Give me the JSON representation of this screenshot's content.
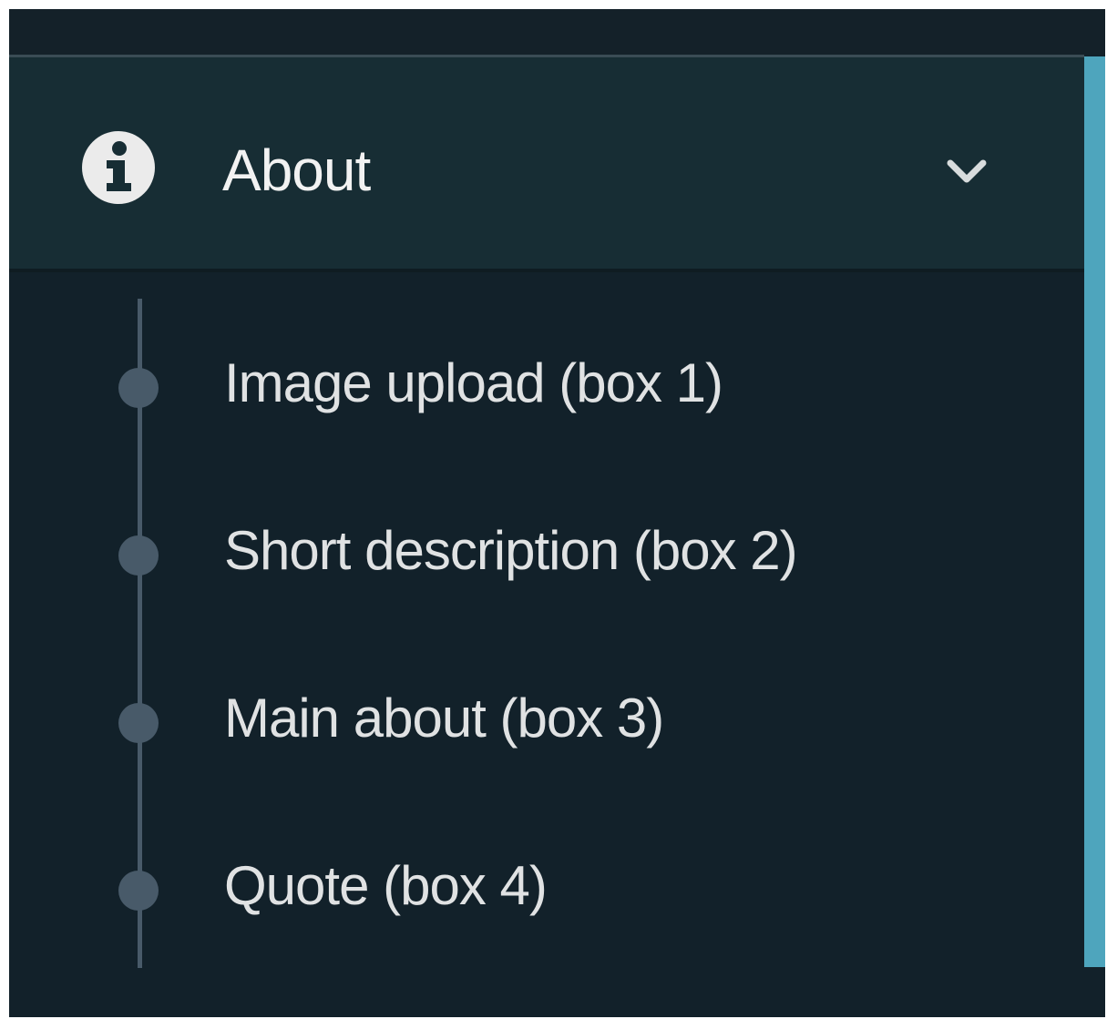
{
  "menu": {
    "section": {
      "label": "About",
      "icon": "info-icon",
      "expand_icon": "chevron-down-icon",
      "expanded": true
    },
    "items": [
      {
        "label": "Image upload (box 1)"
      },
      {
        "label": "Short description (box 2)"
      },
      {
        "label": "Main about (box 3)"
      },
      {
        "label": "Quote (box 4)"
      }
    ]
  },
  "colors": {
    "background": "#12212a",
    "header_background": "#172d34",
    "accent": "#4ea5bd",
    "text": "#e0e2e3",
    "timeline": "#485a69"
  }
}
